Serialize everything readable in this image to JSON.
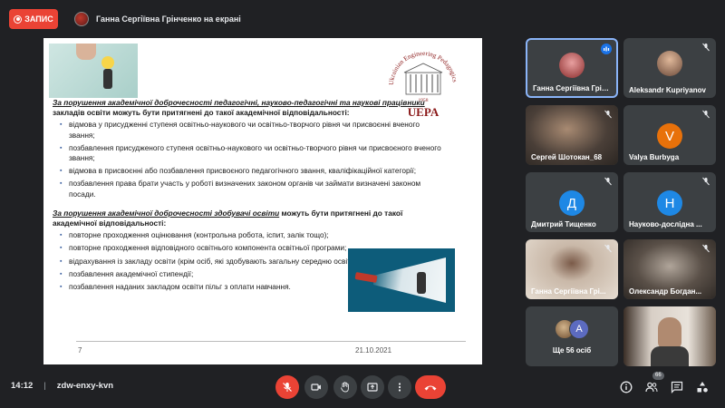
{
  "top": {
    "record_label": "ЗАПИС",
    "presenter_text": "Ганна Сергіївна Грінченко на екрані"
  },
  "slide": {
    "logo_arc_text": "Ukrainian Engineering Pedagogics Academy",
    "logo_year": "1958",
    "logo_acronym": "UEPA",
    "sec1_intro_italic": "За порушення академічної доброчесності педагогічні,  науково-педагогічні та наукові працівники",
    "sec1_intro_rest": " закладів освіти  можуть бути притягнені до такої академічної відповідальності:",
    "sec1_items": [
      "відмова у присудженні ступеня освітньо-наукового чи освітньо-творчого рівня чи присвоєнні вченого звання;",
      "позбавлення присудженого ступеня освітньо-наукового чи освітньо-творчого рівня чи присвоєного вченого звання;",
      "відмова в присвоєнні або позбавлення присвоєного педагогічного звання, кваліфікаційної категорії;",
      "позбавлення права брати участь у роботі визначених законом органів чи займати визначені законом посади."
    ],
    "sec2_intro_italic": "За порушення академічної доброчесності здобувачі освіти",
    "sec2_intro_rest": " можуть бути притягнені до такої академічної відповідальності:",
    "sec2_items": [
      "повторне проходження оцінювання (контрольна робота, іспит, залік тощо);",
      "повторне проходження відповідного освітнього компонента освітньої програми;",
      "відрахування із закладу освіти (крім осіб, які здобувають загальну середню освіту);",
      "позбавлення академічної стипендії;",
      "позбавлення наданих закладом освіти пільг з оплати навчання."
    ],
    "page_number": "7",
    "date": "21.10.2021"
  },
  "participants": [
    {
      "name": "Ганна Сергіївна Грін...",
      "kind": "photo",
      "color": "#8a2b2b",
      "mic": "talking"
    },
    {
      "name": "Aleksandr Kupriyanov",
      "kind": "photo",
      "color": "#6b4a3a",
      "mic": "muted"
    },
    {
      "name": "Сергей Шотокан_68",
      "kind": "camera",
      "color": "#4a3f38",
      "mic": "muted"
    },
    {
      "name": "Valya Burbyga",
      "kind": "letter",
      "letter": "V",
      "color": "#e8710a",
      "mic": "muted"
    },
    {
      "name": "Дмитрий Тищенко",
      "kind": "letter",
      "letter": "Д",
      "color": "#1e88e5",
      "mic": "muted"
    },
    {
      "name": "Науково-дослідна ...",
      "kind": "letter",
      "letter": "Н",
      "color": "#1e88e5",
      "mic": "muted"
    },
    {
      "name": "Ганна Сергіївна Грі...",
      "kind": "camera",
      "color": "#c9b8a8",
      "mic": "muted"
    },
    {
      "name": "Олександр Богдан...",
      "kind": "camera",
      "color": "#5a5048",
      "mic": "muted"
    },
    {
      "name": "Ще 56 осіб",
      "kind": "more",
      "letter": "А",
      "color": "#5c6bc0"
    },
    {
      "name": "",
      "kind": "camera",
      "color": "#d8cfc6",
      "mic": "muted"
    }
  ],
  "bottom": {
    "time": "14:12",
    "separator": "|",
    "meeting_code": "zdw-enxy-kvn",
    "participants_badge": "66"
  },
  "colors": {
    "record_red": "#ea4335",
    "active_border": "#8ab4f8",
    "bar_bg": "#202124",
    "control_bg": "#3c4043"
  }
}
